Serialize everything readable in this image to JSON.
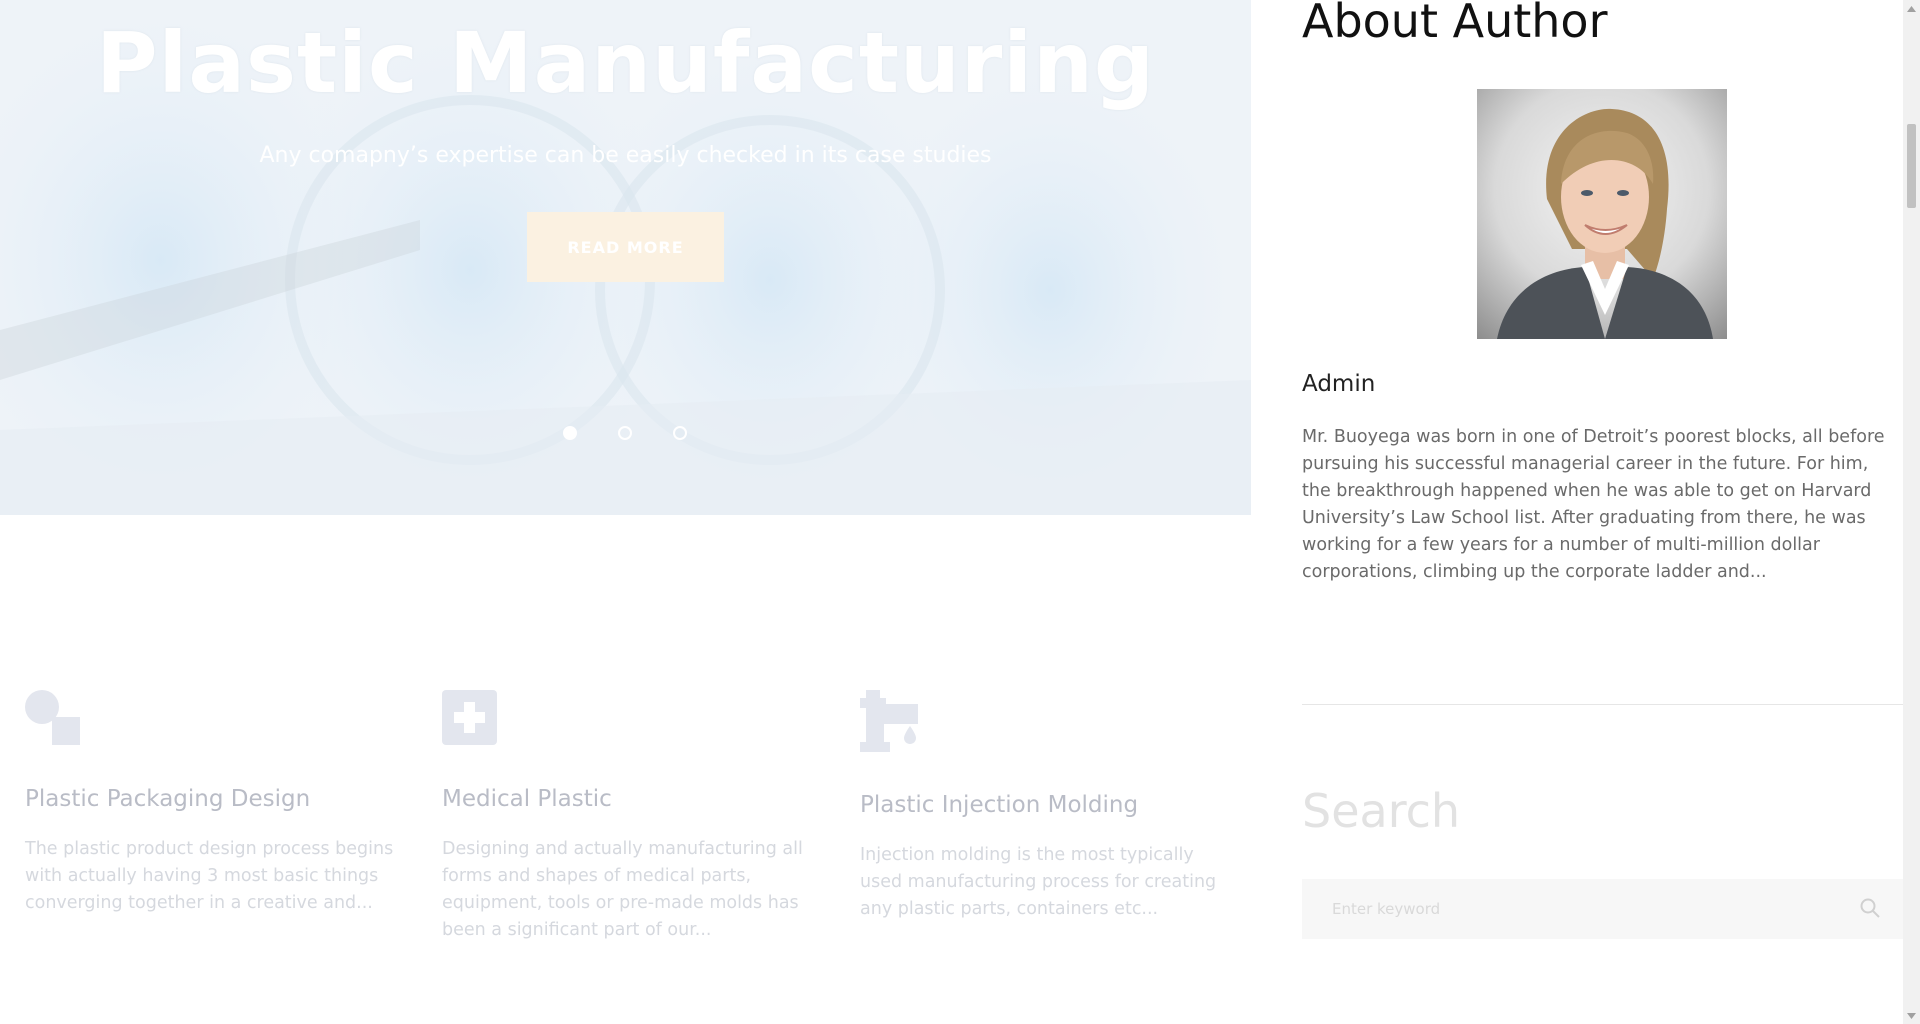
{
  "hero": {
    "title": "Plastic Manufacturing",
    "subtitle": "Any comapny’s expertise can be easily checked in its case studies",
    "button_label": "READ MORE",
    "slides": [
      {
        "label": "slide-1",
        "active": true
      },
      {
        "label": "slide-2",
        "active": false
      },
      {
        "label": "slide-3",
        "active": false
      }
    ],
    "accent_color": "#fbf1e1"
  },
  "services": [
    {
      "icon": "shapes-icon",
      "title": "Plastic Packaging Design",
      "text": "The plastic product design process begins with actually having 3 most basic things converging together in a creative and..."
    },
    {
      "icon": "medical-cross-icon",
      "title": "Medical Plastic",
      "text": "Designing and actually manufacturing all forms and shapes of medical parts, equipment, tools or pre-made molds has been a significant part of our..."
    },
    {
      "icon": "injection-molding-icon",
      "title": "Plastic Injection Molding",
      "text": "Injection molding is the most typically used manufacturing process for creating any plastic parts, containers etc..."
    }
  ],
  "sidebar": {
    "about": {
      "title": "About Author",
      "name": "Admin",
      "bio": "Mr. Buoyega was born in one of Detroit’s poorest blocks, all before pursuing his successful managerial career in the future. For him, the breakthrough happened when he was able to get on Harvard University’s Law School list. After graduating from there, he was working for a few years for a number of multi-million dollar corporations, climbing up the corporate ladder and..."
    },
    "search": {
      "title": "Search",
      "placeholder": "Enter keyword",
      "icon": "search-icon"
    }
  }
}
